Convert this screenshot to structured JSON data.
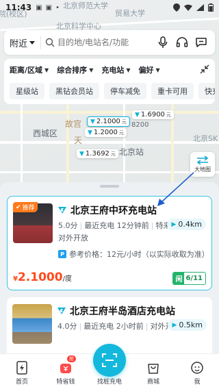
{
  "status_bar": {
    "time": "11:43"
  },
  "map": {
    "labels": {
      "top_left": "院(校区)",
      "top_mid": "北京师范大学",
      "top_right": "贸易大学",
      "science": "北京科学中心",
      "palace": "故宫",
      "xicheng": "西城区",
      "tian": "天",
      "bj_station": "北京站",
      "right_edge": "北京SK",
      "num_fragment": "8200"
    },
    "price_pins": [
      {
        "value": "2.1000",
        "unit": "元",
        "selected": true
      },
      {
        "value": "1.6900",
        "unit": "元",
        "selected": false
      },
      {
        "value": "1.2000",
        "unit": "元",
        "selected": false
      },
      {
        "value": "1.3692",
        "unit": "元",
        "selected": false
      }
    ],
    "big_map_label": "大地图"
  },
  "search": {
    "nearby_label": "附近",
    "placeholder": "目的地/电站名/功能"
  },
  "filters": {
    "dropdowns": [
      "距离/区域",
      "综合排序",
      "充电站",
      "偏好"
    ],
    "chips": [
      "星级站",
      "黑钻会员站",
      "停车减免",
      "重卡可用",
      "快充"
    ]
  },
  "stations": [
    {
      "badge": "推荐",
      "name": "北京王府中环充电站",
      "rating": "5.0分",
      "recent": "最近充电 12分钟前",
      "feature": "特来电权益",
      "open": "对外开放",
      "distance": "0.4km",
      "ref_price": "参考价格：12元/小时（以实际收取为准）",
      "price_symbol": "¥",
      "price": "2.1000",
      "price_unit": "/度",
      "avail_key": "闲",
      "avail_free": "6",
      "avail_total": "/11"
    },
    {
      "name": "北京王府半岛酒店充电站",
      "rating": "4.0分",
      "recent": "最近充电 2小时前",
      "open": "对外开放",
      "distance": "0.5km"
    }
  ],
  "bottom_nav": {
    "items": [
      "首页",
      "特省钱",
      "找桩充电",
      "商城",
      "我"
    ],
    "badge": "抢"
  },
  "colors": {
    "accent": "#14b8dc",
    "price": "#ff4a1c",
    "available": "#25b36b",
    "recommend": "#ff7a1a"
  }
}
